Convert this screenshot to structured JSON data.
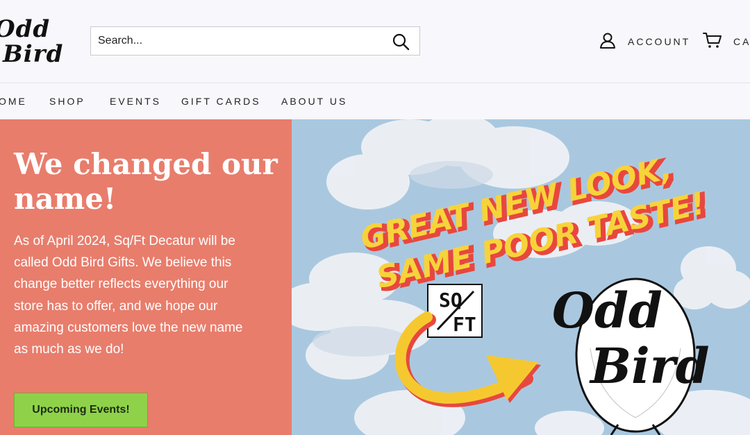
{
  "header": {
    "logo_line1": "Odd",
    "logo_line2": "Bird",
    "search_placeholder": "Search...",
    "account_label": "ACCOUNT",
    "cart_label": "CA"
  },
  "nav": {
    "items": [
      "OME",
      "SHOP",
      "EVENTS",
      "GIFT CARDS",
      "ABOUT US"
    ]
  },
  "hero": {
    "title": "We changed our name!",
    "body": "As of April 2024, Sq/Ft Decatur will be called Odd Bird Gifts. We believe this change better reflects everything our store has to offer, and we hope our amazing customers love the new name as much as we do!",
    "button_label": "Upcoming Events!",
    "banner": {
      "line1": "GREAT NEW LOOK,",
      "line2": "SAME POOR TASTE!",
      "old_logo_line1": "SQ",
      "old_logo_line2": "FT",
      "new_logo_line1": "Odd",
      "new_logo_line2": "Bird"
    }
  },
  "colors": {
    "page_bg": "#f8f7fb",
    "hero_left_bg": "#e87d6c",
    "hero_right_bg": "#a9c8df",
    "button_bg": "#8fd24a",
    "banner_text": "#f7d33a",
    "banner_shadow": "#e8473f",
    "arrow": "#f6c830"
  }
}
